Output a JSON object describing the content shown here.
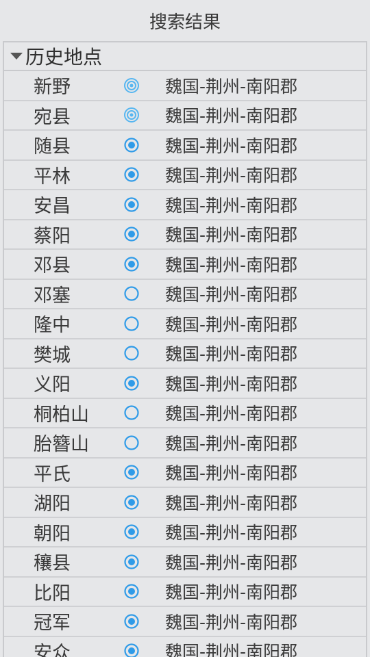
{
  "header": {
    "title": "搜索结果"
  },
  "group": {
    "title": "历史地点"
  },
  "colors": {
    "accent": "#2f9be8",
    "double_ring": "#57b6f0"
  },
  "rows": [
    {
      "name": "新野",
      "status": "double-ring-icon",
      "location": "魏国-荆州-南阳郡"
    },
    {
      "name": "宛县",
      "status": "double-ring-icon",
      "location": "魏国-荆州-南阳郡"
    },
    {
      "name": "随县",
      "status": "filled-dot-icon",
      "location": "魏国-荆州-南阳郡"
    },
    {
      "name": "平林",
      "status": "filled-dot-icon",
      "location": "魏国-荆州-南阳郡"
    },
    {
      "name": "安昌",
      "status": "filled-dot-icon",
      "location": "魏国-荆州-南阳郡"
    },
    {
      "name": "蔡阳",
      "status": "filled-dot-icon",
      "location": "魏国-荆州-南阳郡"
    },
    {
      "name": "邓县",
      "status": "filled-dot-icon",
      "location": "魏国-荆州-南阳郡"
    },
    {
      "name": "邓塞",
      "status": "empty-ring-icon",
      "location": "魏国-荆州-南阳郡"
    },
    {
      "name": "隆中",
      "status": "empty-ring-icon",
      "location": "魏国-荆州-南阳郡"
    },
    {
      "name": "樊城",
      "status": "empty-ring-icon",
      "location": "魏国-荆州-南阳郡"
    },
    {
      "name": "义阳",
      "status": "filled-dot-icon",
      "location": "魏国-荆州-南阳郡"
    },
    {
      "name": "桐柏山",
      "status": "empty-ring-icon",
      "location": "魏国-荆州-南阳郡"
    },
    {
      "name": "胎簪山",
      "status": "empty-ring-icon",
      "location": "魏国-荆州-南阳郡"
    },
    {
      "name": "平氏",
      "status": "filled-dot-icon",
      "location": "魏国-荆州-南阳郡"
    },
    {
      "name": "湖阳",
      "status": "filled-dot-icon",
      "location": "魏国-荆州-南阳郡"
    },
    {
      "name": "朝阳",
      "status": "filled-dot-icon",
      "location": "魏国-荆州-南阳郡"
    },
    {
      "name": "穰县",
      "status": "filled-dot-icon",
      "location": "魏国-荆州-南阳郡"
    },
    {
      "name": "比阳",
      "status": "filled-dot-icon",
      "location": "魏国-荆州-南阳郡"
    },
    {
      "name": "冠军",
      "status": "filled-dot-icon",
      "location": "魏国-荆州-南阳郡"
    },
    {
      "name": "安众",
      "status": "filled-dot-icon",
      "location": "魏国-荆州-南阳郡"
    }
  ]
}
